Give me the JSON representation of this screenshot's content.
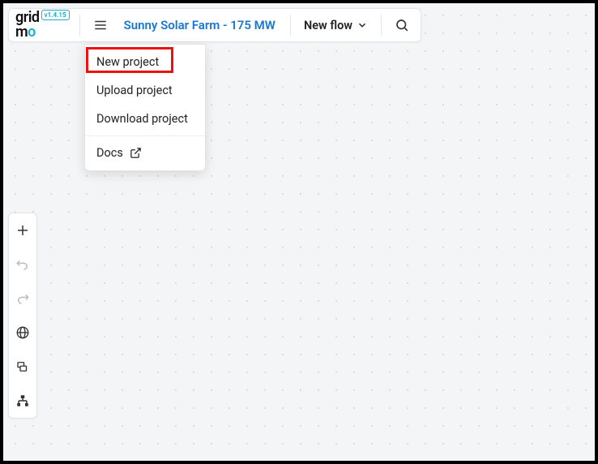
{
  "logo": {
    "text": "grid mo",
    "version": "v1.4.15"
  },
  "topbar": {
    "project_name": "Sunny Solar Farm - 175 MW",
    "new_flow_label": "New flow"
  },
  "menu": {
    "items": [
      {
        "label": "New project",
        "highlighted": true
      },
      {
        "label": "Upload project"
      },
      {
        "label": "Download project"
      },
      {
        "label": "Docs",
        "external": true
      }
    ]
  },
  "side_tools": [
    {
      "name": "add",
      "icon": "plus"
    },
    {
      "name": "undo",
      "icon": "undo",
      "dim": true
    },
    {
      "name": "redo",
      "icon": "redo",
      "dim": true
    },
    {
      "name": "globe",
      "icon": "globe"
    },
    {
      "name": "layers",
      "icon": "layers"
    },
    {
      "name": "tree",
      "icon": "tree"
    }
  ]
}
